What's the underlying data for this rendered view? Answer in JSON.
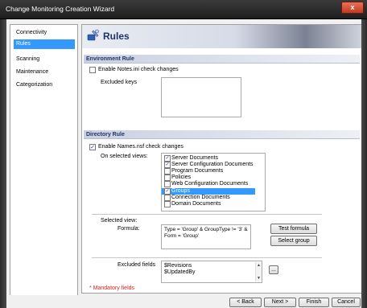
{
  "window": {
    "title": "Change Monitoring Creation Wizard",
    "close_label": "x"
  },
  "nav": {
    "items": [
      {
        "label": "Connectivity",
        "selected": false
      },
      {
        "label": "Rules",
        "selected": true
      },
      {
        "label": "Scanning",
        "selected": false
      },
      {
        "label": "Maintenance",
        "selected": false
      },
      {
        "label": "Categorization",
        "selected": false
      }
    ]
  },
  "header": {
    "title": "Rules",
    "icon": "tools-icon"
  },
  "environment": {
    "section_title": "Environment Rule",
    "enable_label": "Enable Notes.ini check changes",
    "enable_checked": false,
    "excluded_keys_label": "Excluded keys"
  },
  "directory": {
    "section_title": "Directory Rule",
    "enable_label": "Enable Names.nsf check changes",
    "enable_checked": true,
    "views_label": "On selected views:",
    "views": [
      {
        "label": "Server Documents",
        "checked": true,
        "selected": false
      },
      {
        "label": "Server Configuration Documents",
        "checked": true,
        "selected": false
      },
      {
        "label": "Program Documents",
        "checked": false,
        "selected": false
      },
      {
        "label": "Policies",
        "checked": false,
        "selected": false
      },
      {
        "label": "Web Configuration Documents",
        "checked": false,
        "selected": false
      },
      {
        "label": "Groups",
        "checked": true,
        "selected": true
      },
      {
        "label": "Connection Documents",
        "checked": false,
        "selected": false
      },
      {
        "label": "Domain Documents",
        "checked": false,
        "selected": false
      }
    ],
    "selected_view_label": "Selected view:",
    "formula_label": "Formula:",
    "formula_value": "Type = 'Group' & GroupType != '3' & Form = 'Group'",
    "test_formula_label": "Test formula",
    "select_group_label": "Select group",
    "excluded_fields_label": "Excluded fields",
    "excluded_fields": [
      "$Revisions",
      "$UpdatedBy"
    ],
    "browse_label": "..."
  },
  "mandatory_note": "* Mandatory fields",
  "buttons": {
    "back": "< Back",
    "next": "Next >",
    "finish": "Finish",
    "cancel": "Cancel"
  },
  "colors": {
    "selection": "#3399ff",
    "section_text": "#1e3466",
    "mandatory": "#e02020"
  }
}
